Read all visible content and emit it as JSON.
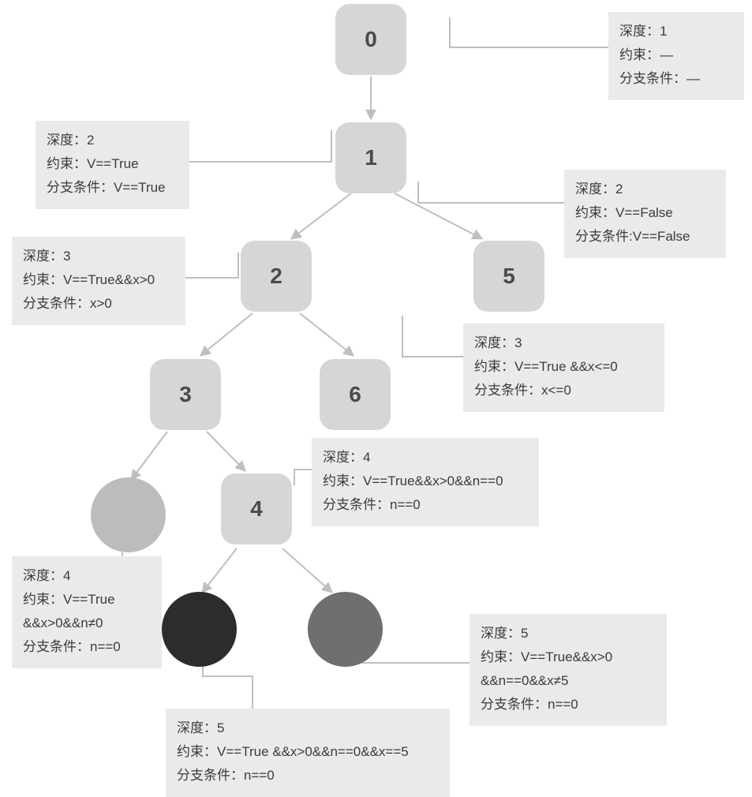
{
  "keys": {
    "depth": "深度：",
    "constraint": "约束：",
    "branch": "分支条件"
  },
  "nodes": {
    "n0": "0",
    "n1": "1",
    "n2": "2",
    "n3": "3",
    "n4": "4",
    "n5": "5",
    "n6": "6"
  },
  "labels": {
    "l0": {
      "depth": "1",
      "constraint": "—",
      "branch_sep": "：",
      "branch": "—"
    },
    "l1L": {
      "depth": "2",
      "constraint": "V==True",
      "branch_sep": "：",
      "branch": "V==True"
    },
    "l1R": {
      "depth": "2",
      "constraint": "V==False",
      "branch_sep": ":",
      "branch": "V==False"
    },
    "l2": {
      "depth": "3",
      "constraint": "V==True&&x>0",
      "branch_sep": "：",
      "branch": "x>0"
    },
    "l5": {
      "depth": "3",
      "constraint": "V==True &&x<=0",
      "branch_sep": "：",
      "branch": "x<=0"
    },
    "l4label": {
      "depth": "4",
      "constraint": "V==True&&x>0&&n==0",
      "branch_sep": "：",
      "branch": "n==0"
    },
    "lgrey": {
      "depth": "4",
      "constraint_l1": "V==True",
      "constraint_l2": "&&x>0&&n≠0",
      "branch_sep": "：",
      "branch": "n==0"
    },
    "ldark": {
      "depth": "5",
      "constraint": "V==True &&x>0&&n==0&&x==5",
      "branch_sep": "：",
      "branch": "n==0"
    },
    "lmid": {
      "depth": "5",
      "constraint_l1": "V==True&&x>0",
      "constraint_l2": "&&n==0&&x≠5",
      "branch_sep": "：",
      "branch": "n==0"
    }
  }
}
